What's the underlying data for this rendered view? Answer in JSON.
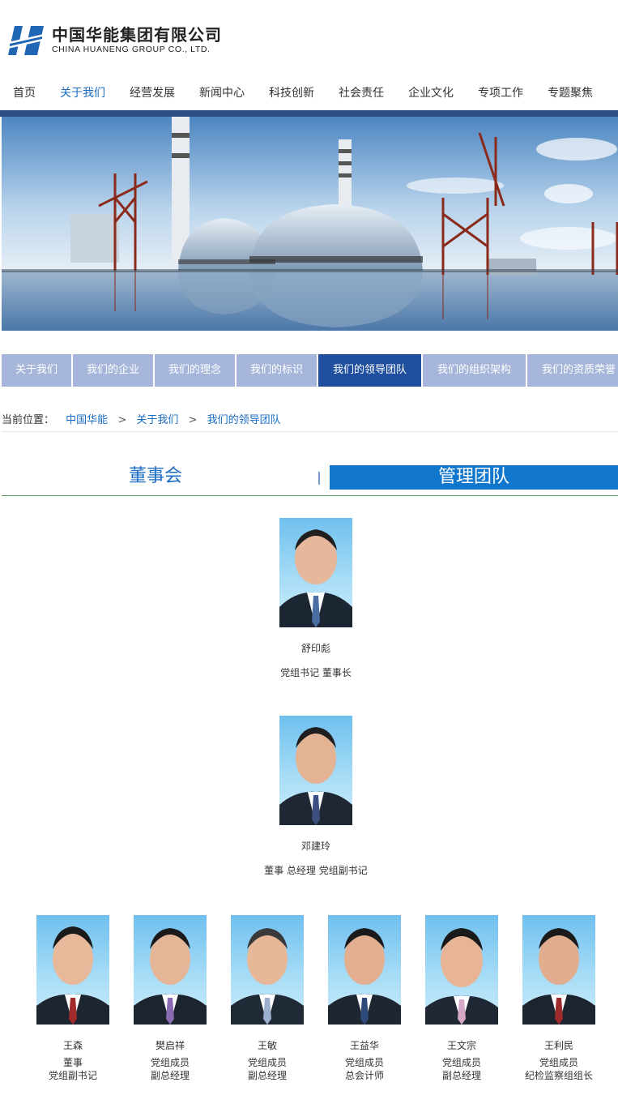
{
  "brand": {
    "name_cn": "中国华能集团有限公司",
    "name_en": "CHINA HUANENG GROUP CO., LTD.",
    "logo_color": "#1f66b4"
  },
  "nav": {
    "items": [
      "首页",
      "关于我们",
      "经营发展",
      "新闻中心",
      "科技创新",
      "社会责任",
      "企业文化",
      "专项工作",
      "专题聚焦"
    ],
    "active": "关于我们"
  },
  "subnav": {
    "items": [
      "关于我们",
      "我们的企业",
      "我们的理念",
      "我们的标识",
      "我们的领导团队",
      "我们的组织架构",
      "我们的资质荣誉"
    ],
    "active": "我们的领导团队"
  },
  "breadcrumb": {
    "label": "当前位置：",
    "items": [
      "中国华能",
      "关于我们",
      "我们的领导团队"
    ],
    "separator": ">"
  },
  "tabs": {
    "board": "董事会",
    "management": "管理团队",
    "active": "管理团队",
    "divider": "|"
  },
  "leaders": {
    "top": [
      {
        "name": "舒印彪",
        "title": "党组书记 董事长"
      },
      {
        "name": "邓建玲",
        "title": "董事 总经理 党组副书记"
      }
    ],
    "row": [
      {
        "name": "王森",
        "title1": "董事",
        "title2": "党组副书记"
      },
      {
        "name": "樊启祥",
        "title1": "党组成员",
        "title2": "副总经理"
      },
      {
        "name": "王敏",
        "title1": "党组成员",
        "title2": "副总经理"
      },
      {
        "name": "王益华",
        "title1": "党组成员",
        "title2": "总会计师"
      },
      {
        "name": "王文宗",
        "title1": "党组成员",
        "title2": "副总经理"
      },
      {
        "name": "王利民",
        "title1": "党组成员",
        "title2": "纪检监察组组长"
      }
    ]
  },
  "colors": {
    "accent": "#1a6cc4",
    "nav_bar": "#2e4f86",
    "subnav_bg": "#a5b6da",
    "subnav_active": "#1f4f9e",
    "tab_active": "#1177cc"
  }
}
